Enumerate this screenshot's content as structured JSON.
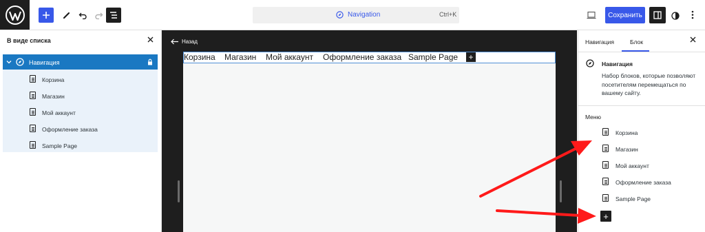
{
  "header": {
    "command_label": "Navigation",
    "command_shortcut": "Ctrl+K",
    "save_label": "Сохранить"
  },
  "list_view": {
    "title": "В виде списка",
    "root": {
      "label": "Навигация"
    },
    "items": [
      {
        "label": "Корзина"
      },
      {
        "label": "Магазин"
      },
      {
        "label": "Мой аккаунт"
      },
      {
        "label": "Оформление заказа"
      },
      {
        "label": "Sample Page"
      }
    ]
  },
  "canvas": {
    "back_label": "Назад",
    "menu_items": [
      {
        "label": "Корзина"
      },
      {
        "label": "Магазин"
      },
      {
        "label": "Мой аккаунт"
      },
      {
        "label": "Оформление заказа"
      },
      {
        "label": "Sample Page"
      }
    ],
    "add_glyph": "+"
  },
  "sidebar": {
    "tabs": [
      {
        "label": "Навигация",
        "active": false
      },
      {
        "label": "Блок",
        "active": true
      }
    ],
    "block_title": "Навигация",
    "block_description": "Набор блоков, которые позволяют посетителям перемещаться по вашему сайту.",
    "menu_title": "Меню",
    "menu_items": [
      {
        "label": "Корзина"
      },
      {
        "label": "Магазин"
      },
      {
        "label": "Мой аккаунт"
      },
      {
        "label": "Оформление заказа"
      },
      {
        "label": "Sample Page"
      }
    ],
    "add_glyph": "+"
  },
  "colors": {
    "accent": "#3858e9",
    "selected_row": "#1a78c2",
    "annotation_arrow": "#ff1a1a"
  },
  "icons": [
    "wordpress-logo-icon",
    "plus-icon",
    "pencil-icon",
    "undo-icon",
    "redo-icon",
    "list-view-icon",
    "compass-icon",
    "desktop-icon",
    "settings-panel-icon",
    "styles-icon",
    "more-vertical-icon",
    "close-icon",
    "chevron-down-icon",
    "lock-icon",
    "page-icon",
    "arrow-left-icon"
  ]
}
